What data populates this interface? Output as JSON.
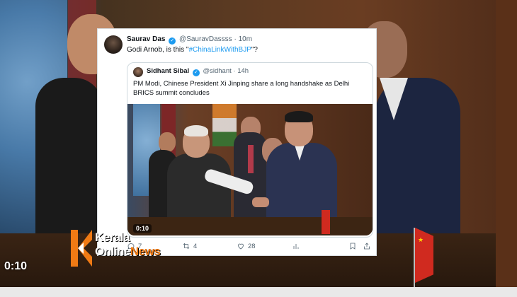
{
  "video": {
    "time_label": "0:10"
  },
  "tweet": {
    "author_name": "Saurav Das",
    "author_handle": "@SauravDassss",
    "separator": "·",
    "age": "10m",
    "text_before": "Godi Arnob, is this \"",
    "hashtag": "#ChinaLinkWithBJP",
    "text_after": "\"?",
    "verified_icon": "verified-badge-icon",
    "quote": {
      "author_name": "Sidhant Sibal",
      "author_handle": "@sidhant",
      "separator": "·",
      "age": "14h",
      "text": "PM Modi, Chinese President Xi Jinping share a long handshake as Delhi BRICS summit concludes",
      "media_time": "0:10"
    },
    "actions": {
      "reply_count": "7",
      "retweet_count": "4",
      "like_count": "28"
    }
  },
  "watermark": {
    "line1": "Kerala",
    "line2_a": "Online",
    "line2_b": "News",
    "accent": "#f07a14",
    "letter": "K"
  },
  "colors": {
    "link": "#1d9bf0",
    "muted": "#536471",
    "text": "#0f1419"
  }
}
